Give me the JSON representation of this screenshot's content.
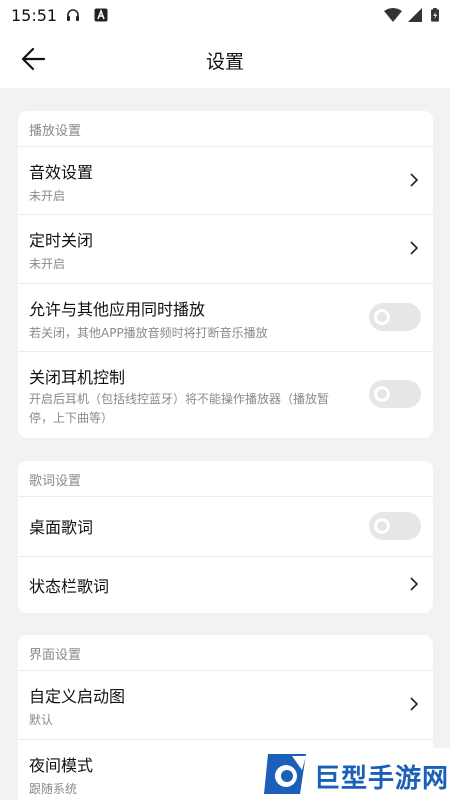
{
  "status_bar": {
    "time": "15:51",
    "icons": [
      "headphones-icon",
      "letter-a-icon",
      "wifi-icon",
      "signal-icon",
      "battery-icon"
    ]
  },
  "header": {
    "back_icon": "arrow-left-icon",
    "title": "设置"
  },
  "sections": {
    "playback": {
      "title": "播放设置",
      "items": [
        {
          "label": "音效设置",
          "sub": "未开启",
          "control": "chevron"
        },
        {
          "label": "定时关闭",
          "sub": "未开启",
          "control": "chevron"
        },
        {
          "label": "允许与其他应用同时播放",
          "sub": "若关闭，其他APP播放音频时将打断音乐播放",
          "control": "toggle",
          "on": false
        },
        {
          "label": "关闭耳机控制",
          "sub": "开启后耳机（包括线控蓝牙）将不能操作播放器（播放暂停，上下曲等）",
          "control": "toggle",
          "on": false
        }
      ]
    },
    "lyrics": {
      "title": "歌词设置",
      "items": [
        {
          "label": "桌面歌词",
          "control": "toggle",
          "on": false
        },
        {
          "label": "状态栏歌词",
          "control": "chevron"
        }
      ]
    },
    "interface": {
      "title": "界面设置",
      "items": [
        {
          "label": "自定义启动图",
          "sub": "默认",
          "control": "chevron"
        },
        {
          "label": "夜间模式",
          "sub": "跟随系统"
        }
      ]
    }
  },
  "watermark": {
    "text": "巨型手游网"
  },
  "colors": {
    "background": "#f2f2f2",
    "card": "#ffffff",
    "secondary_text": "#8a8a8a",
    "toggle_off": "#e6e6e6",
    "watermark_blue": "#1a5fb8"
  }
}
